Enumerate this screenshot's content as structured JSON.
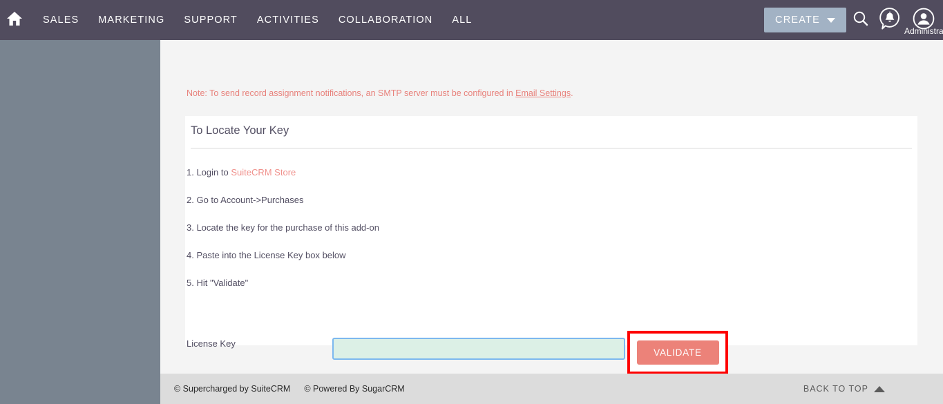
{
  "header": {
    "home_icon": "home-icon",
    "nav_items": [
      {
        "label": "SALES"
      },
      {
        "label": "MARKETING"
      },
      {
        "label": "SUPPORT"
      },
      {
        "label": "ACTIVITIES"
      },
      {
        "label": "COLLABORATION"
      },
      {
        "label": "ALL"
      }
    ],
    "create_label": "CREATE",
    "search_icon": "search-icon",
    "notification_icon": "notification-bell-icon",
    "user_icon": "user-avatar-icon",
    "user_name": "Administrator",
    "chevron_icon": "chevron-down-icon",
    "bg_color": "#514c5e",
    "create_bg_color": "#a2b2c4"
  },
  "sidebar": {
    "toggle_icon": "collapse-left-icon",
    "bg_color": "#798490"
  },
  "main": {
    "note": {
      "prefix": "Note: To send record assignment notifications, an SMTP server must be configured in ",
      "link_label": "Email Settings",
      "suffix": ".",
      "color": "#e8827c"
    },
    "panel": {
      "title": "To Locate Your Key",
      "steps": [
        {
          "prefix": "1. Login to ",
          "link_label": "SuiteCRM Store",
          "suffix": ""
        },
        {
          "prefix": "2. Go to Account->Purchases",
          "link_label": "",
          "suffix": ""
        },
        {
          "prefix": "3. Locate the key for the purchase of this add-on",
          "link_label": "",
          "suffix": ""
        },
        {
          "prefix": "4. Paste into the License Key box below",
          "link_label": "",
          "suffix": ""
        },
        {
          "prefix": "5. Hit \"Validate\"",
          "link_label": "",
          "suffix": ""
        }
      ],
      "license_key_label": "License Key",
      "license_key_value": "",
      "license_key_placeholder": "",
      "validate_label": "VALIDATE",
      "validate_bg_color": "#ec8279",
      "highlight_color": "#fe0000",
      "input_bg_color": "#dcf0e6",
      "input_border_color": "#7cb8ef"
    }
  },
  "footer": {
    "credits": [
      {
        "label": "© Supercharged by SuiteCRM"
      },
      {
        "label": "© Powered By SugarCRM"
      }
    ],
    "back_to_top_label": "BACK TO TOP",
    "back_to_top_icon": "triangle-up-icon",
    "bg_color": "#dcdcdc"
  }
}
